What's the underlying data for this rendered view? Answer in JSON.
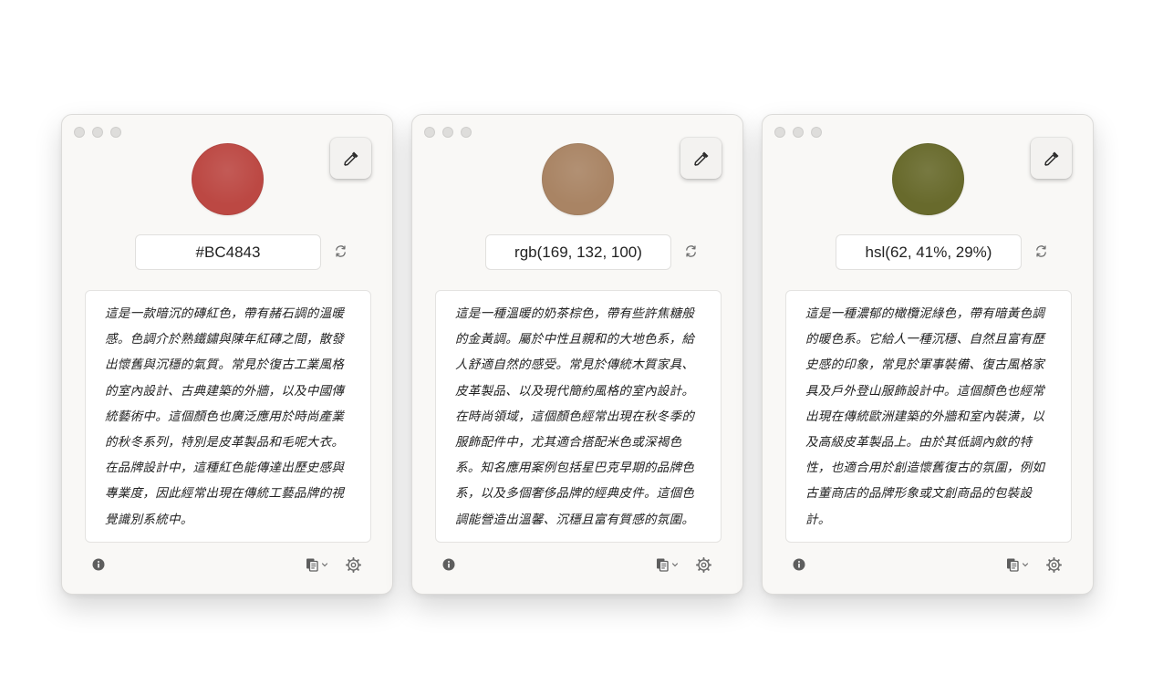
{
  "cards": [
    {
      "color": "#BC4843",
      "value": "#BC4843",
      "description": "這是一款暗沉的磚紅色，帶有赭石調的溫暖感。色調介於熟鐵鏽與陳年紅磚之間，散發出懷舊與沉穩的氣質。常見於復古工業風格的室內設計、古典建築的外牆，以及中國傳統藝術中。這個顏色也廣泛應用於時尚產業的秋冬系列，特別是皮革製品和毛呢大衣。在品牌設計中，這種紅色能傳達出歷史感與專業度，因此經常出現在傳統工藝品牌的視覺識別系統中。"
    },
    {
      "color": "#A98464",
      "value": "rgb(169, 132, 100)",
      "description": "這是一種溫暖的奶茶棕色，帶有些許焦糖般的金黃調。屬於中性且親和的大地色系，給人舒適自然的感受。常見於傳統木質家具、皮革製品、以及現代簡約風格的室內設計。在時尚領域，這個顏色經常出現在秋冬季的服飾配件中，尤其適合搭配米色或深褐色系。知名應用案例包括星巴克早期的品牌色系，以及多個奢侈品牌的經典皮件。這個色調能營造出溫馨、沉穩且富有質感的氛圍。"
    },
    {
      "color": "#686A2C",
      "value": "hsl(62, 41%, 29%)",
      "description": "這是一種濃郁的橄欖泥綠色，帶有暗黃色調的暖色系。它給人一種沉穩、自然且富有歷史感的印象，常見於軍事裝備、復古風格家具及戶外登山服飾設計中。這個顏色也經常出現在傳統歐洲建築的外牆和室內裝潢，以及高級皮革製品上。由於其低調內斂的特性，也適合用於創造懷舊復古的氛圍，例如古董商店的品牌形象或文創商品的包裝設計。"
    }
  ],
  "icons": {
    "picker": "eyedropper-icon",
    "refresh": "refresh-icon",
    "info": "info-icon",
    "copy": "copy-icon",
    "settings": "gear-icon"
  }
}
